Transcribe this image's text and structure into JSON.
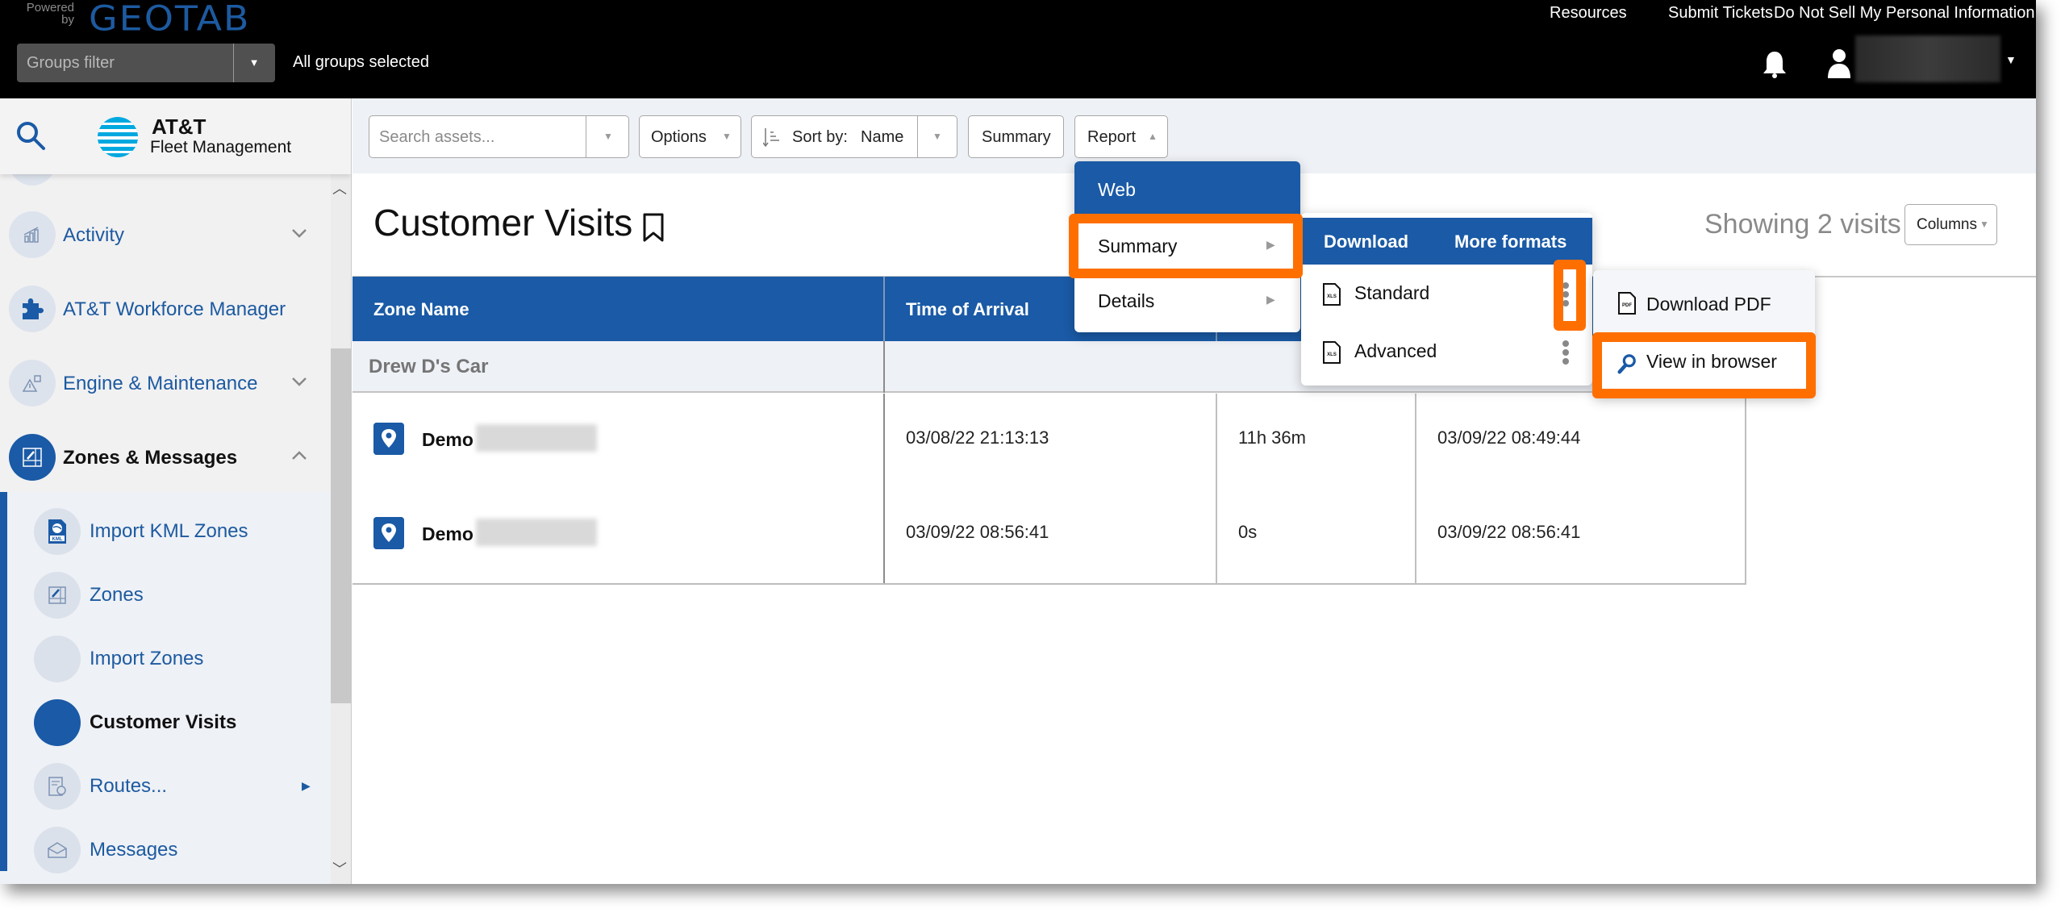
{
  "topbar": {
    "powered_by": "Powered by",
    "brand": "GEOTAB",
    "groups_filter_placeholder": "Groups filter",
    "groups_status": "All groups selected",
    "links": [
      "Resources",
      "Submit Tickets",
      "Do Not Sell My Personal Information"
    ],
    "icons": {
      "notifications": "bell-icon",
      "user": "user-icon",
      "user_menu": "caret-down-icon"
    }
  },
  "sidebar": {
    "logo_title": "AT&T",
    "logo_subtitle": "Fleet Management",
    "items": [
      {
        "label": "Activity",
        "icon": "bar-chart-icon",
        "expanded": false
      },
      {
        "label": "AT&T Workforce Manager",
        "icon": "puzzle-icon",
        "expanded": null
      },
      {
        "label": "Engine & Maintenance",
        "icon": "engine-warning-icon",
        "expanded": false
      },
      {
        "label": "Zones & Messages",
        "icon": "zones-icon",
        "expanded": true,
        "active": true
      }
    ],
    "subitems": [
      {
        "label": "Import KML Zones",
        "icon": "kml-file-icon"
      },
      {
        "label": "Zones",
        "icon": "zones-icon"
      },
      {
        "label": "Import Zones",
        "icon": ""
      },
      {
        "label": "Customer Visits",
        "icon": "",
        "active": true
      },
      {
        "label": "Routes...",
        "icon": "routes-icon",
        "has_submenu": true
      },
      {
        "label": "Messages",
        "icon": "envelope-icon"
      }
    ]
  },
  "toolbar": {
    "search_placeholder": "Search assets...",
    "options_label": "Options",
    "sort_label": "Sort by:",
    "sort_value": "Name",
    "summary_label": "Summary",
    "report_label": "Report"
  },
  "page": {
    "title": "Customer Visits",
    "showing": "Showing 2 visits",
    "columns_label": "Columns"
  },
  "table": {
    "headers": [
      "Zone Name",
      "Time of Arrival",
      "",
      ""
    ],
    "groups": [
      {
        "name": "Drew D's Car",
        "rows": [
          {
            "zone": "Demo",
            "arrival": "03/08/22 21:13:13",
            "duration": "11h 36m",
            "departure": "03/09/22 08:49:44"
          },
          {
            "zone": "Demo",
            "arrival": "03/09/22 08:56:41",
            "duration": "0s",
            "departure": "03/09/22 08:56:41"
          }
        ]
      }
    ]
  },
  "report_menu": {
    "items": [
      {
        "label": "Web",
        "selected": true
      },
      {
        "label": "Summary",
        "has_submenu": true,
        "highlighted": true
      },
      {
        "label": "Details",
        "has_submenu": true
      }
    ]
  },
  "summary_submenu": {
    "tabs": [
      "Download",
      "More formats"
    ],
    "items": [
      {
        "label": "Standard",
        "icon": "xls-file-icon",
        "kebab_highlighted": true
      },
      {
        "label": "Advanced",
        "icon": "xls-file-icon"
      }
    ]
  },
  "format_menu": {
    "items": [
      {
        "label": "Download PDF",
        "icon": "pdf-file-icon"
      },
      {
        "label": "View in browser",
        "icon": "magnifier-icon",
        "highlighted": true
      }
    ]
  },
  "colors": {
    "brand_blue": "#1a5aa6",
    "highlight_orange": "#ff6f00",
    "topbar_bg": "#000000"
  }
}
